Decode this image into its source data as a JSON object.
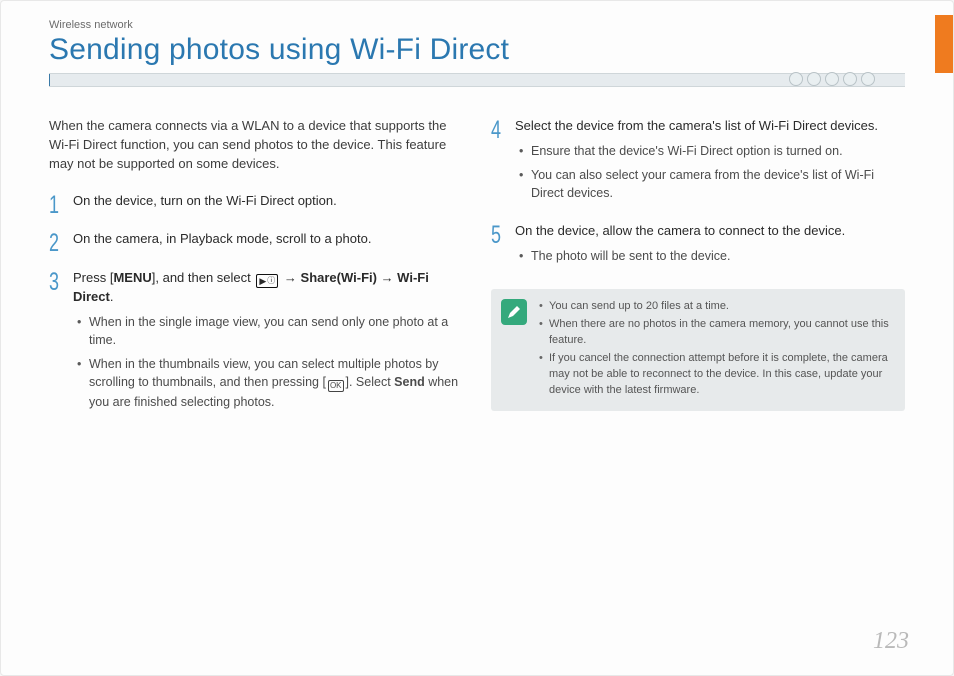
{
  "header": {
    "breadcrumb": "Wireless network",
    "title": "Sending photos using Wi-Fi Direct"
  },
  "intro": "When the camera connects via a WLAN to a device that supports the Wi-Fi Direct function, you can send photos to the device. This feature may not be supported on some devices.",
  "steps_left": [
    {
      "num": "1",
      "text": "On the device, turn on the Wi-Fi Direct option."
    },
    {
      "num": "2",
      "text": "On the camera, in Playback mode, scroll to a photo."
    },
    {
      "num": "3",
      "text_pre": "Press [",
      "text_menu": "MENU",
      "text_mid": "], and then select ",
      "text_share": " → Share(Wi-Fi) → Wi-Fi Direct",
      "text_post": ".",
      "subs": [
        "When in the single image view, you can send only one photo at a time.",
        {
          "pre": "When in the thumbnails view, you can select multiple photos by scrolling to thumbnails, and then pressing [",
          "ok": "OK",
          "mid": "]. Select ",
          "send": "Send",
          "post": " when you are finished selecting photos."
        }
      ]
    }
  ],
  "steps_right": [
    {
      "num": "4",
      "text": "Select the device from the camera's list of Wi-Fi Direct devices.",
      "subs": [
        "Ensure that the device's Wi-Fi Direct option is turned on.",
        "You can also select your camera from the device's list of Wi-Fi Direct devices."
      ]
    },
    {
      "num": "5",
      "text": "On the device, allow the camera to connect to the device.",
      "subs": [
        "The photo will be sent to the device."
      ]
    }
  ],
  "notes": [
    "You can send up to 20 files at a time.",
    "When there are no photos in the camera memory, you cannot use this feature.",
    "If you cancel the connection attempt before it is complete, the camera may not be able to reconnect to the device. In this case, update your device with the latest firmware."
  ],
  "page_number": "123"
}
